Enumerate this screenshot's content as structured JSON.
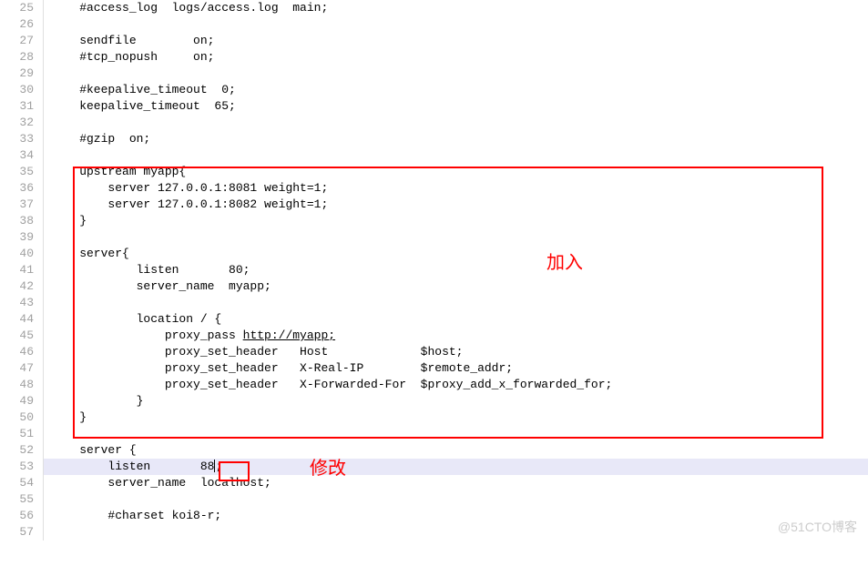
{
  "lines": [
    {
      "num": "25",
      "text": "    #access_log  logs/access.log  main;"
    },
    {
      "num": "26",
      "text": ""
    },
    {
      "num": "27",
      "text": "    sendfile        on;"
    },
    {
      "num": "28",
      "text": "    #tcp_nopush     on;"
    },
    {
      "num": "29",
      "text": ""
    },
    {
      "num": "30",
      "text": "    #keepalive_timeout  0;"
    },
    {
      "num": "31",
      "text": "    keepalive_timeout  65;"
    },
    {
      "num": "32",
      "text": ""
    },
    {
      "num": "33",
      "text": "    #gzip  on;"
    },
    {
      "num": "34",
      "text": ""
    },
    {
      "num": "35",
      "text": "    upstream myapp{"
    },
    {
      "num": "36",
      "text": "        server 127.0.0.1:8081 weight=1;"
    },
    {
      "num": "37",
      "text": "        server 127.0.0.1:8082 weight=1;"
    },
    {
      "num": "38",
      "text": "    }"
    },
    {
      "num": "39",
      "text": ""
    },
    {
      "num": "40",
      "text": "    server{"
    },
    {
      "num": "41",
      "text": "            listen       80;"
    },
    {
      "num": "42",
      "text": "            server_name  myapp;"
    },
    {
      "num": "43",
      "text": ""
    },
    {
      "num": "44",
      "text": "            location / {"
    },
    {
      "num": "45",
      "text": "                proxy_pass ",
      "link": "http://myapp;"
    },
    {
      "num": "46",
      "text": "                proxy_set_header   Host             $host;"
    },
    {
      "num": "47",
      "text": "                proxy_set_header   X-Real-IP        $remote_addr;"
    },
    {
      "num": "48",
      "text": "                proxy_set_header   X-Forwarded-For  $proxy_add_x_forwarded_for;"
    },
    {
      "num": "49",
      "text": "            }"
    },
    {
      "num": "50",
      "text": "    }"
    },
    {
      "num": "51",
      "text": ""
    },
    {
      "num": "52",
      "text": "    server {"
    },
    {
      "num": "53",
      "text": "        listen       88",
      "tail": ";",
      "highlight": true,
      "cursor": true
    },
    {
      "num": "54",
      "text": "        server_name  localhost;"
    },
    {
      "num": "55",
      "text": ""
    },
    {
      "num": "56",
      "text": "        #charset koi8-r;"
    },
    {
      "num": "57",
      "text": ""
    }
  ],
  "annotations": {
    "a1": "加入",
    "a2": "修改"
  },
  "watermark": "@51CTO博客"
}
